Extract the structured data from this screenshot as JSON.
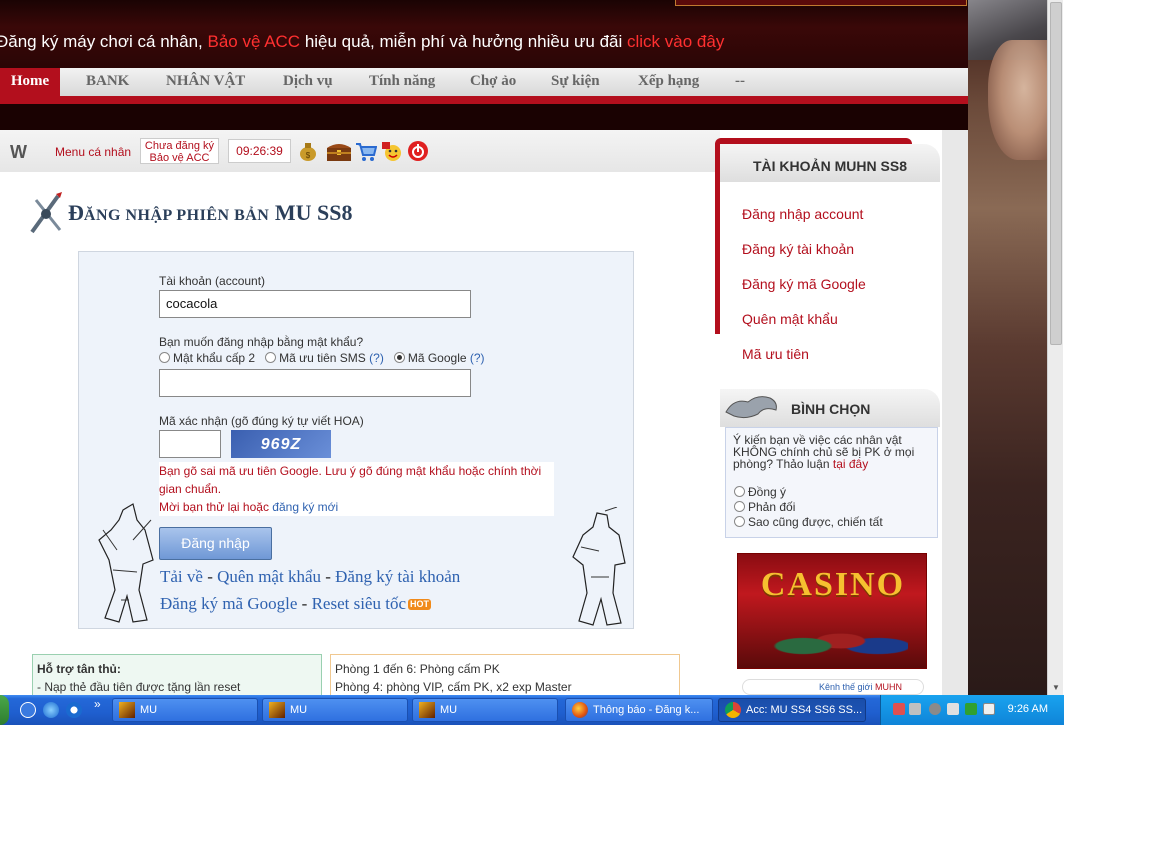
{
  "promo": {
    "text1": "Đăng ký máy chơi cá nhân, ",
    "text2": "Bảo vệ ACC",
    "text3": " hiệu quả, miễn phí và hưởng nhiều ưu đãi ",
    "text4": "click vào đây"
  },
  "nav": {
    "items": [
      "Home",
      "BANK",
      "NHÂN VẬT",
      "Dịch vụ",
      "Tính năng",
      "Chợ ảo",
      "Sự kiện",
      "Xếp hạng",
      "--"
    ]
  },
  "toolbar": {
    "logo": "W",
    "menu_label": "Menu cá nhân",
    "unreg_line1": "Chưa đăng ký",
    "unreg_line2": "Bảo vệ ACC",
    "clock": "09:26:39",
    "icons": [
      "money-bag-icon",
      "treasure-chest-icon",
      "shopping-cart-icon",
      "gift-smiley-icon",
      "power-icon"
    ]
  },
  "page": {
    "title_big1": "Đ",
    "title_small": "ĂNG NHẬP PHIÊN BẢN",
    "title_big2": "MU SS8"
  },
  "login": {
    "account_label": "Tài khoản (account)",
    "account_value": "cocacola",
    "method_label": "Bạn muốn đăng nhập bằng mật khẩu?",
    "methods": [
      {
        "label": "Mật khẩu cấp 2",
        "selected": false
      },
      {
        "label": "Mã ưu tiên SMS",
        "help": "(?)",
        "selected": false
      },
      {
        "label": "Mã Google",
        "help": "(?)",
        "selected": true
      }
    ],
    "password_value": "",
    "captcha_label": "Mã xác nhận (gõ đúng ký tự viết HOA)",
    "captcha_value": "",
    "captcha_image_text": "969Z",
    "error_text": "Bạn gõ sai mã ưu tiên Google. Lưu ý gõ đúng mật khẩu hoặc chính thời gian chuẩn.",
    "retry_text": "Mời bạn thử lại hoặc ",
    "retry_link": "đăng ký mới",
    "submit_label": "Đăng nhập",
    "links_row1": [
      "Tải về",
      "Quên mật khẩu",
      "Đăng ký tài khoản"
    ],
    "links_row2": [
      "Đăng ký mã Google",
      "Reset siêu tốc"
    ],
    "separator": " - ",
    "hot_badge": "HOT"
  },
  "bottom": {
    "help_title": "Hỗ trợ tân thủ:",
    "help_line1": "- Nạp thẻ đầu tiên được tặng lần reset",
    "rooms_line1": "Phòng 1 đến 6: Phòng cấm PK",
    "rooms_line2": "Phòng 4: phòng VIP, cấm PK, x2 exp Master"
  },
  "sidebar": {
    "account_title": "TÀI KHOẢN MUHN SS8",
    "account_items": [
      "Đăng nhập account",
      "Đăng ký tài khoản",
      "Đăng ký mã Google",
      "Quên mật khẩu",
      "Mã ưu tiên"
    ],
    "poll_title": "BÌNH CHỌN",
    "poll_question": "Ý kiến bạn về việc các nhân vật KHÔNG chính chủ sẽ bị PK ở mọi phòng? Thảo luận ",
    "poll_link": "tại đây",
    "poll_options": [
      "Đồng ý",
      "Phản đối",
      "Sao cũng được, chiến tất"
    ],
    "casino_text": "CASINO",
    "news_prefix": "Kênh thế giới ",
    "news_highlight": "MUHN"
  },
  "taskbar": {
    "tasks": [
      "MU",
      "MU",
      "MU",
      "Thông báo - Đăng k...",
      "Acc: MU SS4 SS6 SS..."
    ],
    "clock": "9:26 AM",
    "chevron": "»"
  },
  "colors": {
    "brand_red": "#b30f1d",
    "link_blue": "#2f62b0",
    "title_navy": "#2b3f5a"
  }
}
